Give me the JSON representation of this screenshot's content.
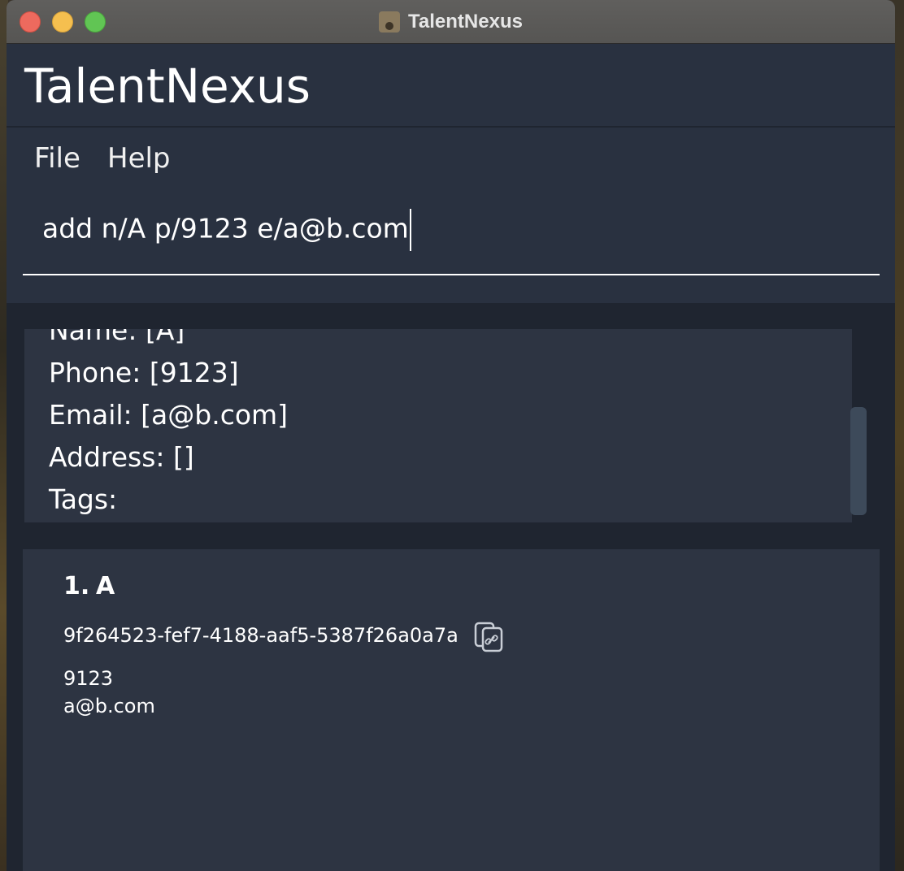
{
  "window": {
    "title": "TalentNexus"
  },
  "app": {
    "name": "TalentNexus"
  },
  "menu": {
    "items": [
      "File",
      "Help"
    ]
  },
  "command": {
    "value": "add n/A p/9123 e/a@b.com"
  },
  "result": {
    "lines": [
      "Name: [A]",
      "Phone: [9123]",
      "Email: [a@b.com]",
      "Address: []",
      "Tags:"
    ]
  },
  "persons": [
    {
      "index": "1.",
      "name": "A",
      "uuid": "9f264523-fef7-4188-aaf5-5387f26a0a7a",
      "phone": "9123",
      "email": "a@b.com",
      "copy_icon": "copy-link-icon"
    }
  ],
  "colors": {
    "background": "#252b36",
    "panel": "#293140",
    "card": "#2d3442",
    "text": "#ffffff"
  },
  "icons": {
    "app_icon": "contacts-icon",
    "copy": "copy-link-icon"
  }
}
